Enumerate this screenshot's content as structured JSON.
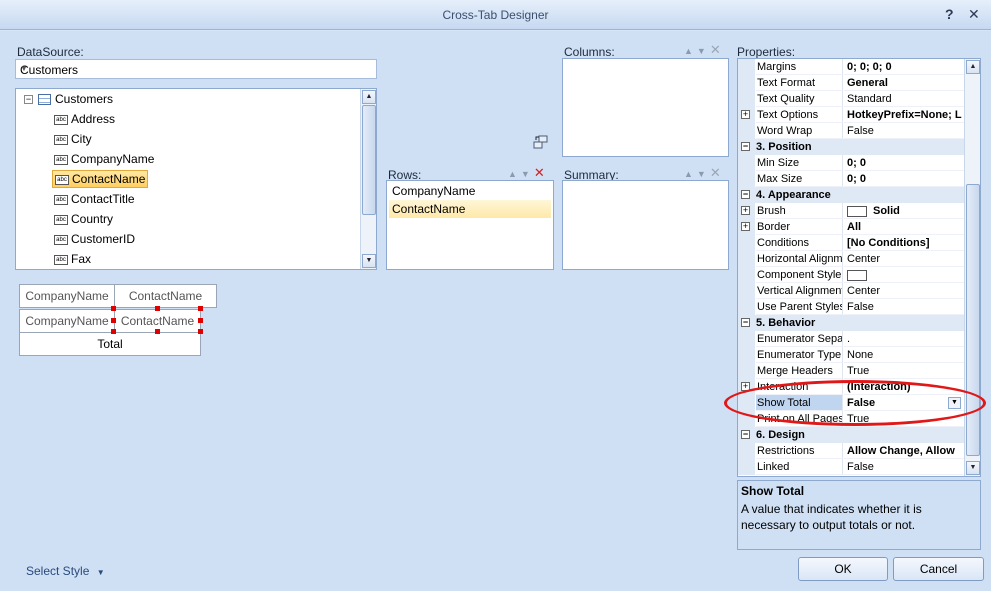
{
  "window": {
    "title": "Cross-Tab Designer",
    "help_glyph": "?",
    "close_glyph": "✕"
  },
  "datasource": {
    "label": "DataSource:",
    "value": "Customers",
    "root": "Customers",
    "fields": [
      "Address",
      "City",
      "CompanyName",
      "ContactName",
      "ContactTitle",
      "Country",
      "CustomerID",
      "Fax"
    ],
    "selected_index": 3,
    "field_icon": "abc"
  },
  "columns": {
    "label": "Columns:"
  },
  "rows": {
    "label": "Rows:",
    "items": [
      "CompanyName",
      "ContactName"
    ],
    "selected_index": 1
  },
  "summary": {
    "label": "Summary:"
  },
  "preview": {
    "header": [
      "CompanyName",
      "ContactName"
    ],
    "row": [
      "CompanyName",
      "ContactName"
    ],
    "total": "Total"
  },
  "properties": {
    "label": "Properties:",
    "rows": [
      {
        "type": "prop",
        "name": "Margins",
        "value": "0; 0; 0; 0",
        "bold": true
      },
      {
        "type": "prop",
        "name": "Text Format",
        "value": "General",
        "bold": true
      },
      {
        "type": "prop",
        "name": "Text Quality",
        "value": "Standard"
      },
      {
        "type": "prop",
        "name": "Text Options",
        "value": "HotkeyPrefix=None; L",
        "bold": true,
        "expandable": true
      },
      {
        "type": "prop",
        "name": "Word Wrap",
        "value": "False"
      },
      {
        "type": "cat",
        "name": "3. Position"
      },
      {
        "type": "prop",
        "name": "Min Size",
        "value": "0; 0",
        "bold": true
      },
      {
        "type": "prop",
        "name": "Max Size",
        "value": "0; 0",
        "bold": true
      },
      {
        "type": "cat",
        "name": "4. Appearance"
      },
      {
        "type": "prop",
        "name": "Brush",
        "value": "Solid",
        "bold": true,
        "expandable": true,
        "swatch": true
      },
      {
        "type": "prop",
        "name": "Border",
        "value": "All",
        "bold": true,
        "expandable": true
      },
      {
        "type": "prop",
        "name": "Conditions",
        "value": "[No Conditions]",
        "bold": true
      },
      {
        "type": "prop",
        "name": "Horizontal Alignme",
        "value": "Center"
      },
      {
        "type": "prop",
        "name": "Component Style",
        "value": "",
        "swatch": true
      },
      {
        "type": "prop",
        "name": "Vertical Alignment",
        "value": "Center"
      },
      {
        "type": "prop",
        "name": "Use Parent Styles",
        "value": "False"
      },
      {
        "type": "cat",
        "name": "5. Behavior"
      },
      {
        "type": "prop",
        "name": "Enumerator Separ",
        "value": "."
      },
      {
        "type": "prop",
        "name": "Enumerator Type",
        "value": "None"
      },
      {
        "type": "prop",
        "name": "Merge Headers",
        "value": "True"
      },
      {
        "type": "prop",
        "name": "Interaction",
        "value": "(Interaction)",
        "bold": true,
        "expandable": true
      },
      {
        "type": "prop",
        "name": "Show Total",
        "value": "False",
        "bold": true,
        "selected": true,
        "dropdown": true
      },
      {
        "type": "prop",
        "name": "Print on All Pages",
        "value": "True"
      },
      {
        "type": "cat",
        "name": "6. Design"
      },
      {
        "type": "prop",
        "name": "Restrictions",
        "value": "Allow Change, Allow",
        "bold": true
      },
      {
        "type": "prop",
        "name": "Linked",
        "value": "False"
      }
    ]
  },
  "description": {
    "title": "Show Total",
    "text": "A value that indicates whether it is necessary to output totals or not."
  },
  "footer": {
    "select_style": "Select Style",
    "ok": "OK",
    "cancel": "Cancel"
  },
  "colors": {
    "selection": "#ffcf5e",
    "highlight_ellipse": "#e01818"
  }
}
